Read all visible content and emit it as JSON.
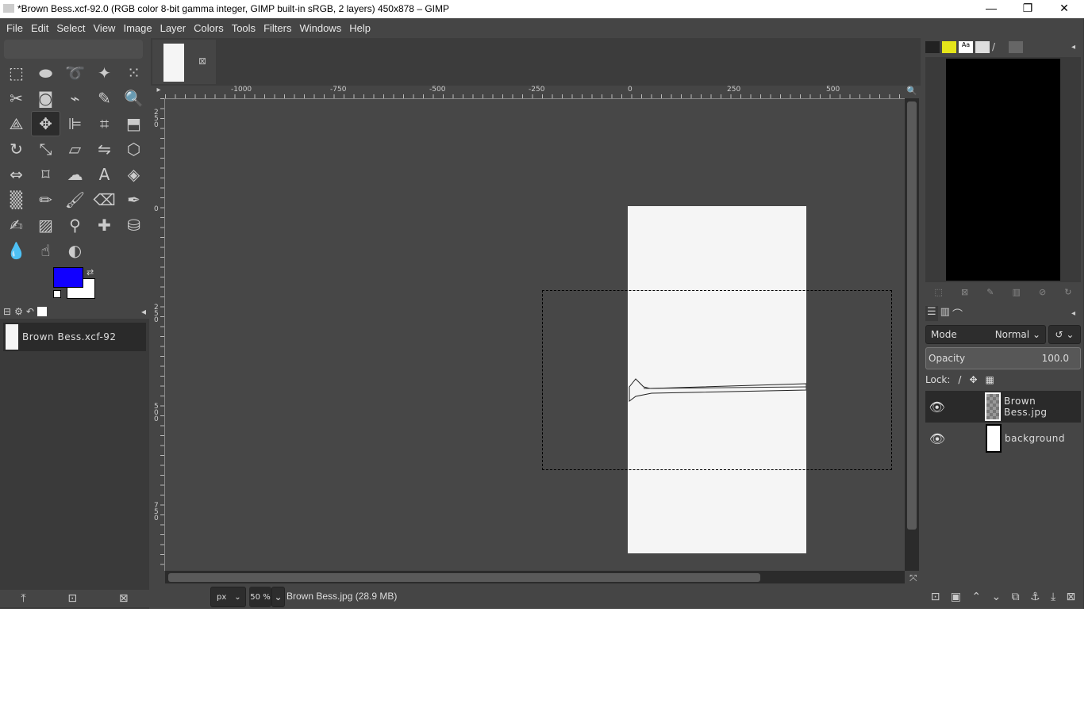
{
  "window": {
    "title": "*Brown Bess.xcf-92.0 (RGB color 8-bit gamma integer, GIMP built-in sRGB, 2 layers) 450x878 – GIMP",
    "minimize": "—",
    "maximize": "❐",
    "close": "✕"
  },
  "menu": [
    "File",
    "Edit",
    "Select",
    "View",
    "Image",
    "Layer",
    "Colors",
    "Tools",
    "Filters",
    "Windows",
    "Help"
  ],
  "tools": [
    {
      "name": "rect-select-icon",
      "g": "⬚"
    },
    {
      "name": "ellipse-select-icon",
      "g": "⬬"
    },
    {
      "name": "free-select-icon",
      "g": "➰"
    },
    {
      "name": "fuzzy-select-icon",
      "g": "✦"
    },
    {
      "name": "select-by-color-icon",
      "g": "⁙"
    },
    {
      "name": "scissors-select-icon",
      "g": "✂"
    },
    {
      "name": "foreground-select-icon",
      "g": "◙"
    },
    {
      "name": "paths-icon",
      "g": "⌁"
    },
    {
      "name": "color-picker-icon",
      "g": "✎"
    },
    {
      "name": "zoom-icon",
      "g": "🔍"
    },
    {
      "name": "measure-icon",
      "g": "⟁"
    },
    {
      "name": "move-icon",
      "g": "✥"
    },
    {
      "name": "align-icon",
      "g": "⊫"
    },
    {
      "name": "crop-icon",
      "g": "⌗"
    },
    {
      "name": "unified-transform-icon",
      "g": "⬒"
    },
    {
      "name": "rotate-icon",
      "g": "↻"
    },
    {
      "name": "scale-icon",
      "g": "⤡"
    },
    {
      "name": "shear-icon",
      "g": "▱"
    },
    {
      "name": "flip-icon",
      "g": "⇋"
    },
    {
      "name": "perspective-icon",
      "g": "⬡"
    },
    {
      "name": "warp-icon",
      "g": "⇔"
    },
    {
      "name": "cage-icon",
      "g": "⌑"
    },
    {
      "name": "handle-transform-icon",
      "g": "☁"
    },
    {
      "name": "text-icon",
      "g": "A"
    },
    {
      "name": "bucket-fill-icon",
      "g": "◈"
    },
    {
      "name": "blend-icon",
      "g": "▒"
    },
    {
      "name": "pencil-icon",
      "g": "✏"
    },
    {
      "name": "paintbrush-icon",
      "g": "🖌"
    },
    {
      "name": "eraser-icon",
      "g": "⌫"
    },
    {
      "name": "airbrush-icon",
      "g": "✒"
    },
    {
      "name": "ink-icon",
      "g": "✍"
    },
    {
      "name": "mypaint-brush-icon",
      "g": "▨"
    },
    {
      "name": "clone-icon",
      "g": "⚲"
    },
    {
      "name": "heal-icon",
      "g": "✚"
    },
    {
      "name": "perspective-clone-icon",
      "g": "⛁"
    },
    {
      "name": "blur-icon",
      "g": "💧"
    },
    {
      "name": "smudge-icon",
      "g": "☝"
    },
    {
      "name": "dodge-burn-icon",
      "g": "◐"
    }
  ],
  "colors": {
    "foreground": "#1100ff",
    "background": "#ffffff"
  },
  "images_dock": {
    "item": "Brown Bess.xcf-92"
  },
  "ruler_top": [
    "-1000",
    "-750",
    "-500",
    "-250",
    "0",
    "250",
    "500"
  ],
  "ruler_left": [
    "250",
    "0",
    "250",
    "500",
    "750"
  ],
  "status": {
    "unit": "px",
    "zoom": "50 %",
    "info": "Brown Bess.jpg (28.9 MB)"
  },
  "layers": {
    "mode_label": "Mode",
    "mode": "Normal",
    "opacity_label": "Opacity",
    "opacity": "100.0",
    "lock_label": "Lock:",
    "items": [
      {
        "name": "Brown Bess.jpg",
        "visible": true
      },
      {
        "name": "background",
        "visible": true
      }
    ]
  }
}
